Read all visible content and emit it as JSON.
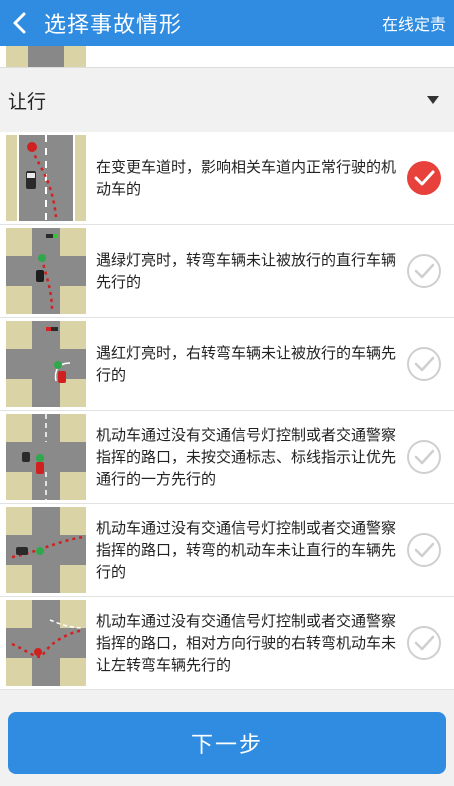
{
  "appbar": {
    "title": "选择事故情形",
    "action": "在线定责"
  },
  "group": {
    "label": "让行"
  },
  "items": [
    {
      "text": "在变更车道时，影响相关车道内正常行驶的机动车的",
      "selected": true
    },
    {
      "text": "遇绿灯亮时，转弯车辆未让被放行的直行车辆先行的",
      "selected": false
    },
    {
      "text": "遇红灯亮时，右转弯车辆未让被放行的车辆先行的",
      "selected": false
    },
    {
      "text": "机动车通过没有交通信号灯控制或者交通警察指挥的路口，未按交通标志、标线指示让优先通行的一方先行的",
      "selected": false
    },
    {
      "text": "机动车通过没有交通信号灯控制或者交通警察指挥的路口，转弯的机动车未让直行的车辆先行的",
      "selected": false
    },
    {
      "text": "机动车通过没有交通信号灯控制或者交通警察指挥的路口，相对方向行驶的右转弯机动车未让左转弯车辆先行的",
      "selected": false
    }
  ],
  "footer": {
    "next_label": "下一步"
  },
  "colors": {
    "primary": "#2f8ce0",
    "selected": "#e8413c",
    "unselected": "#cfcfcf"
  },
  "icons": {
    "back": "chevron-left-icon",
    "caret": "caret-down-icon",
    "selected": "check-circle-filled-icon",
    "unselected": "check-circle-outline-icon"
  }
}
